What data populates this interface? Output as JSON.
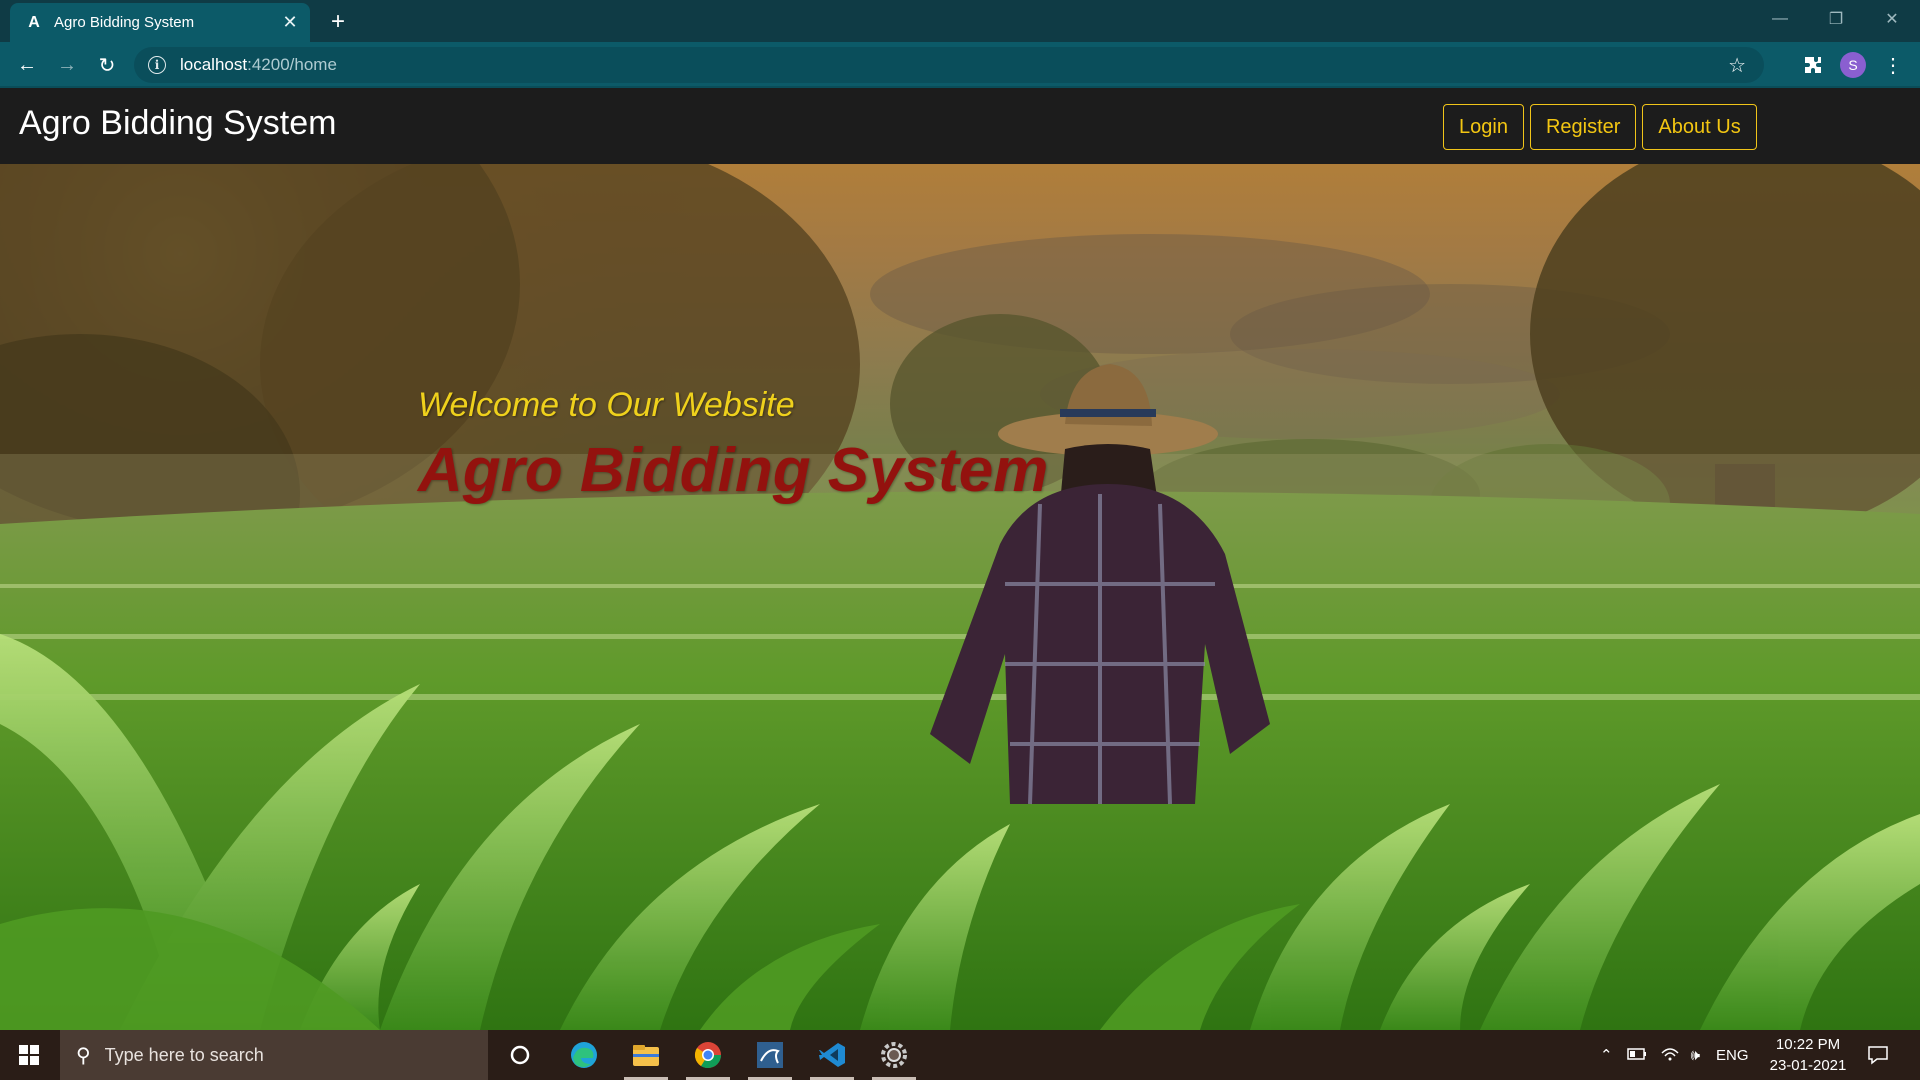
{
  "browser": {
    "tab_title": "Agro Bidding System",
    "tab_favicon": "A",
    "url_host": "localhost",
    "url_path": ":4200/home",
    "profile_initial": "S"
  },
  "header": {
    "brand": "Agro Bidding System",
    "nav": {
      "login": "Login",
      "register": "Register",
      "about": "About Us"
    }
  },
  "hero": {
    "welcome": "Welcome to Our Website",
    "title": "Agro Bidding System"
  },
  "taskbar": {
    "search_placeholder": "Type here to search",
    "language": "ENG",
    "time": "10:22 PM",
    "date": "23-01-2021",
    "apps": [
      "cortana-icon",
      "edge-icon",
      "file-explorer-icon",
      "chrome-icon",
      "mysql-workbench-icon",
      "vscode-icon",
      "settings-gear-icon"
    ]
  },
  "colors": {
    "tabstrip": "#0f3b45",
    "toolbar": "#0c5a68",
    "header_bg": "#1c1c1c",
    "nav_accent": "#f0c419",
    "welcome_text": "#efd11c",
    "hero_title": "#93120e",
    "taskbar": "#2a1d17"
  }
}
